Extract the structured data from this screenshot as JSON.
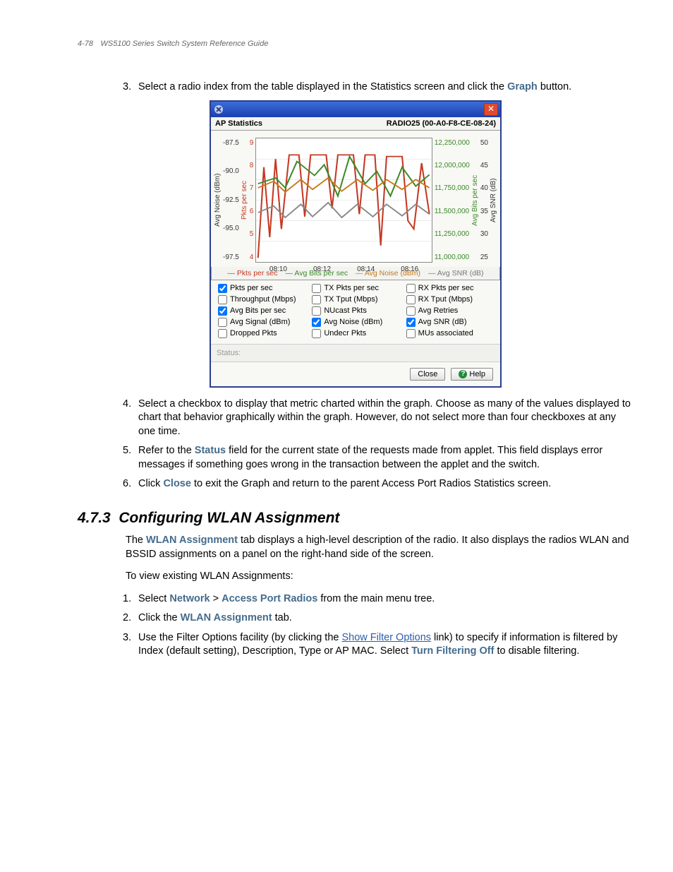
{
  "header": {
    "page": "4-78",
    "title": "WS5100 Series Switch System Reference Guide"
  },
  "steps_a": [
    {
      "n": "3",
      "pre": "Select a radio index from the table displayed in the Statistics screen and click the ",
      "bold": "Graph",
      "post": " button."
    },
    {
      "n": "4",
      "text": "Select a checkbox to display that metric charted within the graph. Choose as many of the values displayed to chart that behavior graphically within the graph. However, do not select more than four checkboxes at any one time."
    },
    {
      "n": "5",
      "pre": "Refer to the ",
      "bold": "Status",
      "post": " field for the current state of the requests made from applet. This field displays error messages if something goes wrong in the transaction between the applet and the switch."
    },
    {
      "n": "6",
      "pre": "Click ",
      "bold": "Close",
      "post": " to exit the Graph and return to the parent Access Port Radios Statistics screen."
    }
  ],
  "section": {
    "num": "4.7.3",
    "title": "Configuring WLAN Assignment"
  },
  "para1": {
    "pre": "The ",
    "bold": "WLAN Assignment",
    "post": " tab displays a high-level description of the radio. It also displays the radios WLAN and BSSID assignments on a panel on the right-hand side of the screen."
  },
  "para2": "To view existing WLAN Assignments:",
  "steps_b": [
    {
      "n": "1",
      "pre": "Select ",
      "b1": "Network",
      "mid": " > ",
      "b2": "Access Port Radios",
      "post": " from the main menu tree."
    },
    {
      "n": "2",
      "pre": "Click the ",
      "bold": "WLAN Assignment",
      "post": " tab."
    },
    {
      "n": "3",
      "pre": "Use the Filter Options facility (by clicking the ",
      "link": "Show Filter Options",
      "mid": " link) to specify if information is filtered by Index (default setting), Description, Type or AP MAC. Select ",
      "bold": "Turn Filtering Off",
      "post": " to disable filtering."
    }
  ],
  "win": {
    "ap_label": "AP Statistics",
    "radio_label": "RADIO25 (00-A0-F8-CE-08-24)",
    "y1_ticks": [
      "-87.5",
      "-90.0",
      "-92.5",
      "-95.0",
      "-97.5"
    ],
    "y1_label": "Avg Noise (dBm)",
    "y2_ticks": [
      "9",
      "8",
      "7",
      "6",
      "5",
      "4"
    ],
    "y2_label": "Pkts per sec",
    "x_ticks": [
      "08:10",
      "08:12",
      "08:14",
      "08:16"
    ],
    "y3_ticks": [
      "12,250,000",
      "12,000,000",
      "11,750,000",
      "11,500,000",
      "11,250,000",
      "11,000,000"
    ],
    "y3_label": "Avg Bits per sec",
    "y4_ticks": [
      "50",
      "45",
      "40",
      "35",
      "30",
      "25"
    ],
    "y4_label": "Avg SNR (dB)",
    "legend": [
      "Pkts per sec",
      "Avg Bits per sec",
      "Avg Noise (dBm)",
      "Avg SNR (dB)"
    ],
    "checks": [
      {
        "label": "Pkts per sec",
        "checked": true
      },
      {
        "label": "TX Pkts per sec",
        "checked": false
      },
      {
        "label": "RX Pkts per sec",
        "checked": false
      },
      {
        "label": "Throughput (Mbps)",
        "checked": false
      },
      {
        "label": "TX Tput (Mbps)",
        "checked": false
      },
      {
        "label": "RX Tput (Mbps)",
        "checked": false
      },
      {
        "label": "Avg Bits per sec",
        "checked": true
      },
      {
        "label": "NUcast Pkts",
        "checked": false
      },
      {
        "label": "Avg Retries",
        "checked": false
      },
      {
        "label": "Avg Signal (dBm)",
        "checked": false
      },
      {
        "label": "Avg Noise (dBm)",
        "checked": true
      },
      {
        "label": "Avg SNR (dB)",
        "checked": true
      },
      {
        "label": "Dropped Pkts",
        "checked": false
      },
      {
        "label": "Undecr Pkts",
        "checked": false
      },
      {
        "label": "MUs associated",
        "checked": false
      }
    ],
    "status_label": "Status:",
    "close": "Close",
    "help": "Help"
  },
  "chart_data": {
    "type": "line",
    "x": [
      "08:10",
      "08:12",
      "08:14",
      "08:16"
    ],
    "series": [
      {
        "name": "Pkts per sec",
        "color": "#c53923",
        "range_hint": [
          4,
          9
        ]
      },
      {
        "name": "Avg Bits per sec",
        "color": "#3a8a2a",
        "range_hint": [
          11000000,
          12250000
        ]
      },
      {
        "name": "Avg Noise (dBm)",
        "color": "#c37a1a",
        "range_hint": [
          -97.5,
          -87.5
        ]
      },
      {
        "name": "Avg SNR (dB)",
        "color": "#777",
        "range_hint": [
          25,
          50
        ]
      }
    ],
    "title": "AP Statistics",
    "note": "multi-axis time-series; values read approximately from screenshot"
  }
}
